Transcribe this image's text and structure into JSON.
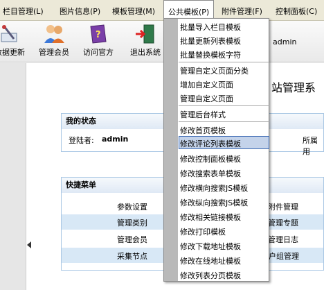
{
  "menubar": {
    "items": [
      "栏目管理(L)",
      "图片信息(P)",
      "模板管理(M)",
      "公共模板(P)",
      "附件管理(F)",
      "控制面板(C)"
    ]
  },
  "toolbar": {
    "buttons": [
      "数据更新",
      "管理会员",
      "访问官方",
      "退出系统"
    ],
    "admin_text": "admin"
  },
  "page_title": "站管理系",
  "status": {
    "heading": "我的状态",
    "login_label": "登陆者:",
    "login_value": "admin",
    "right_text": "所属用"
  },
  "quick": {
    "heading": "快捷菜单",
    "rows": [
      [
        "参数设置",
        "附件管理"
      ],
      [
        "管理类别",
        "管理专题"
      ],
      [
        "管理会员",
        "管理日志"
      ],
      [
        "采集节点",
        "用户组管理"
      ]
    ]
  },
  "dropdown": {
    "groups": [
      [
        "批量导入栏目模板",
        "批量更新列表模板",
        "批量替换模板字符"
      ],
      [
        "管理自定义页面分类",
        "增加自定义页面",
        "管理自定义页面"
      ],
      [
        "管理后台样式"
      ],
      [
        "修改首页模板",
        "修改评论列表模板",
        "修改控制面板模板",
        "修改搜索表单模板",
        "修改横向搜索JS模板",
        "修改纵向搜索JS模板",
        "修改相关链接模板",
        "修改打印模板",
        "修改下载地址模板",
        "修改在线地址模板",
        "修改列表分页模板"
      ]
    ],
    "highlighted": "修改评论列表模板"
  }
}
